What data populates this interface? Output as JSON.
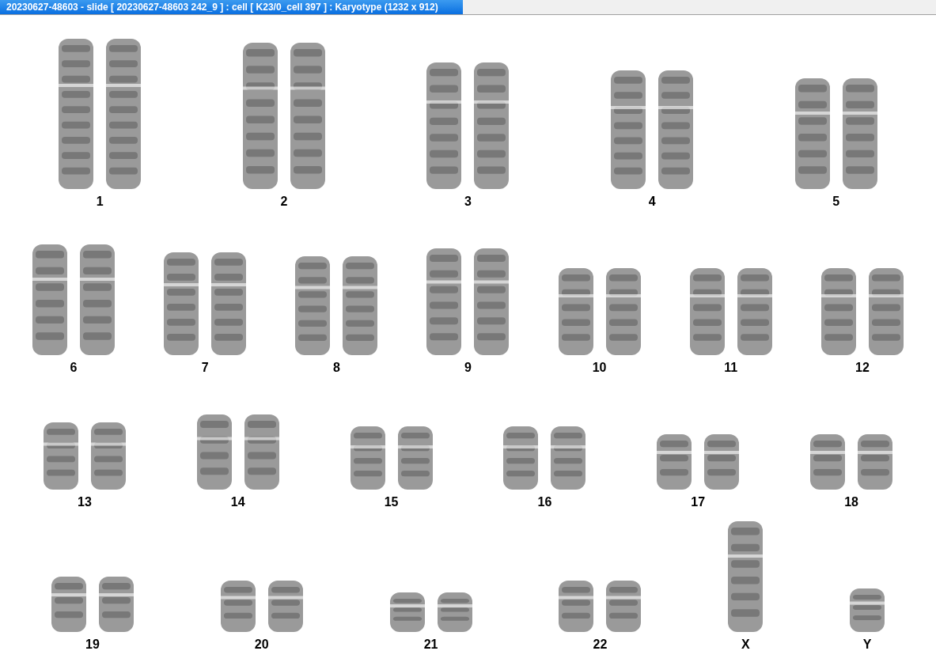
{
  "window": {
    "title": "20230627-48603 - slide [ 20230627-48603 242_9 ] : cell [ K23/0_cell 397 ] : Karyotype  (1232 x 912)"
  },
  "rows": [
    {
      "groups": [
        {
          "label": "1",
          "kind": "pair"
        },
        {
          "label": "2",
          "kind": "pair"
        },
        {
          "label": "3",
          "kind": "pair"
        },
        {
          "label": "4",
          "kind": "pair"
        },
        {
          "label": "5",
          "kind": "pair"
        }
      ]
    },
    {
      "groups": [
        {
          "label": "6",
          "kind": "pair"
        },
        {
          "label": "7",
          "kind": "pair"
        },
        {
          "label": "8",
          "kind": "pair"
        },
        {
          "label": "9",
          "kind": "pair"
        },
        {
          "label": "10",
          "kind": "pair"
        },
        {
          "label": "11",
          "kind": "pair"
        },
        {
          "label": "12",
          "kind": "pair"
        }
      ]
    },
    {
      "groups": [
        {
          "label": "13",
          "kind": "pair"
        },
        {
          "label": "14",
          "kind": "pair"
        },
        {
          "label": "15",
          "kind": "pair"
        },
        {
          "label": "16",
          "kind": "pair"
        },
        {
          "label": "17",
          "kind": "pair"
        },
        {
          "label": "18",
          "kind": "pair"
        }
      ]
    },
    {
      "groups": [
        {
          "label": "19",
          "kind": "pair"
        },
        {
          "label": "20",
          "kind": "pair"
        },
        {
          "label": "21",
          "kind": "pair"
        },
        {
          "label": "22",
          "kind": "pair"
        },
        {
          "label": "X",
          "kind": "single"
        },
        {
          "label": "Y",
          "kind": "single"
        }
      ]
    }
  ]
}
